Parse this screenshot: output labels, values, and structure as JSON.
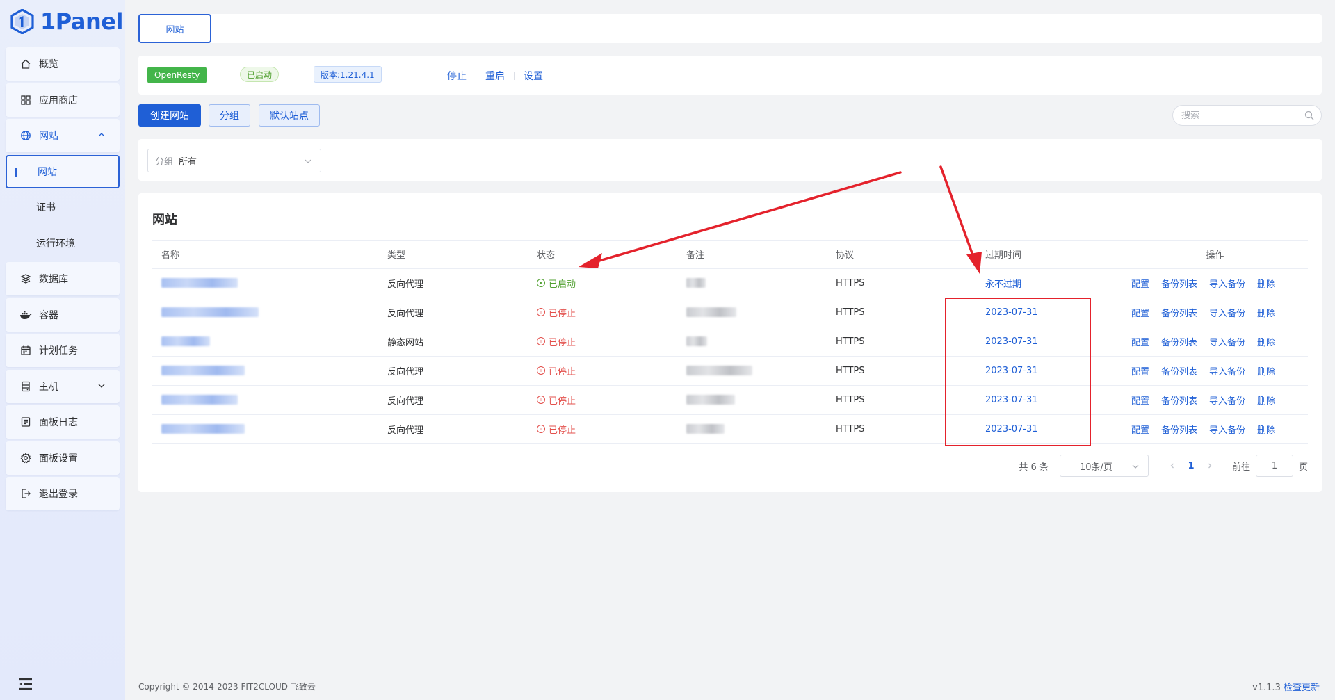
{
  "brand": {
    "name": "1Panel",
    "color": "#1f5fd6"
  },
  "sidebar": {
    "items": [
      {
        "label": "概览",
        "icon": "home-icon"
      },
      {
        "label": "应用商店",
        "icon": "grid-icon"
      },
      {
        "label": "网站",
        "icon": "globe-icon",
        "expanded": true,
        "children": [
          {
            "label": "网站",
            "active": true
          },
          {
            "label": "证书"
          },
          {
            "label": "运行环境"
          }
        ]
      },
      {
        "label": "数据库",
        "icon": "layers-icon"
      },
      {
        "label": "容器",
        "icon": "whale-icon"
      },
      {
        "label": "计划任务",
        "icon": "calendar-icon"
      },
      {
        "label": "主机",
        "icon": "server-icon",
        "collapsible": true
      },
      {
        "label": "面板日志",
        "icon": "log-icon"
      },
      {
        "label": "面板设置",
        "icon": "gear-icon"
      },
      {
        "label": "退出登录",
        "icon": "logout-icon"
      }
    ]
  },
  "tabs": {
    "active": "网站"
  },
  "server": {
    "name": "OpenResty",
    "status": "已启动",
    "version": "版本:1.21.4.1",
    "actions": [
      "停止",
      "重启",
      "设置"
    ]
  },
  "toolbar": {
    "create": "创建网站",
    "group": "分组",
    "default_site": "默认站点",
    "search_placeholder": "搜索"
  },
  "filter": {
    "label": "分组",
    "value": "所有"
  },
  "table": {
    "title": "网站",
    "columns": [
      "名称",
      "类型",
      "状态",
      "备注",
      "协议",
      "过期时间",
      "操作"
    ],
    "rows": [
      {
        "type": "反向代理",
        "status": "已启动",
        "running": true,
        "protocol": "HTTPS",
        "expiry": "永不过期"
      },
      {
        "type": "反向代理",
        "status": "已停止",
        "running": false,
        "protocol": "HTTPS",
        "expiry": "2023-07-31"
      },
      {
        "type": "静态网站",
        "status": "已停止",
        "running": false,
        "protocol": "HTTPS",
        "expiry": "2023-07-31"
      },
      {
        "type": "反向代理",
        "status": "已停止",
        "running": false,
        "protocol": "HTTPS",
        "expiry": "2023-07-31"
      },
      {
        "type": "反向代理",
        "status": "已停止",
        "running": false,
        "protocol": "HTTPS",
        "expiry": "2023-07-31"
      },
      {
        "type": "反向代理",
        "status": "已停止",
        "running": false,
        "protocol": "HTTPS",
        "expiry": "2023-07-31"
      }
    ],
    "row_actions": [
      "配置",
      "备份列表",
      "导入备份",
      "删除"
    ]
  },
  "pagination": {
    "total": "共 6 条",
    "page_size": "10条/页",
    "current": "1",
    "goto_label": "前往",
    "goto_value": "1",
    "page_unit": "页"
  },
  "footer": {
    "copyright": "Copyright © 2014-2023 FIT2CLOUD 飞致云",
    "version": "v1.1.3",
    "update": "检查更新"
  },
  "colors": {
    "primary": "#1f5fd6",
    "success": "#52a132",
    "danger": "#e3504c",
    "annotation": "#e4222c"
  }
}
